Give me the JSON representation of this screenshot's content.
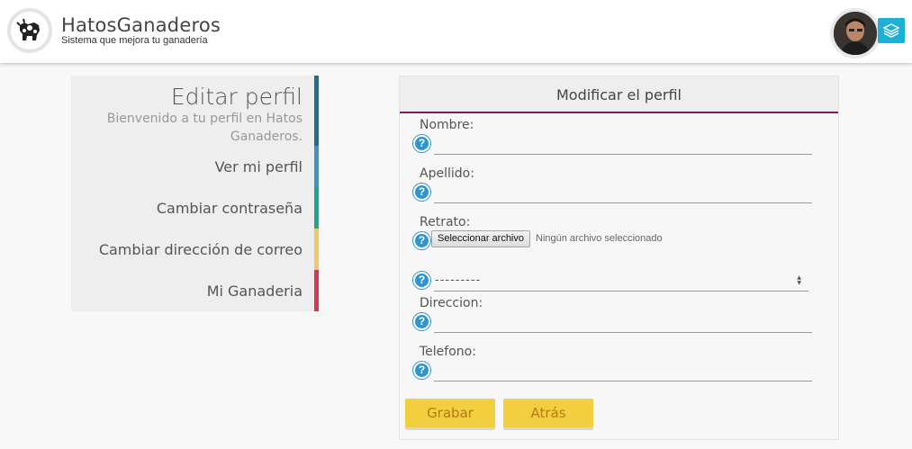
{
  "header": {
    "brand": "HatosGanaderos",
    "tagline": "Sistema que mejora tu ganadería",
    "logo_icon": "cow-icon",
    "avatar_icon": "user-avatar",
    "layers_icon": "layers-icon",
    "accent": "#1cb0d6"
  },
  "sidebar": {
    "title": "Editar perfil",
    "subtitle": "Bienvenido a tu perfil en Hatos Ganaderos.",
    "items": [
      {
        "label": "Ver mi perfil",
        "color": "#3a93c9"
      },
      {
        "label": "Cambiar contraseña",
        "color": "#1aaa8a"
      },
      {
        "label": "Cambiar dirección de correo",
        "color": "#f6c567"
      },
      {
        "label": "Mi Ganaderia",
        "color": "#d9394e"
      }
    ],
    "title_bar_color": "#226d8a"
  },
  "form": {
    "title": "Modificar el perfil",
    "accent": "#7d1a6a",
    "fields": {
      "nombre": {
        "label": "Nombre:",
        "value": ""
      },
      "apellido": {
        "label": "Apellido:",
        "value": ""
      },
      "retrato": {
        "label": "Retrato:",
        "button": "Seleccionar archivo",
        "status": "Ningún archivo seleccionado"
      },
      "select": {
        "value": "---------"
      },
      "direccion": {
        "label": "Direccion:",
        "value": ""
      },
      "telefono": {
        "label": "Telefono:",
        "value": ""
      }
    },
    "help_glyph": "?",
    "save_label": "Grabar",
    "back_label": "Atrás"
  }
}
